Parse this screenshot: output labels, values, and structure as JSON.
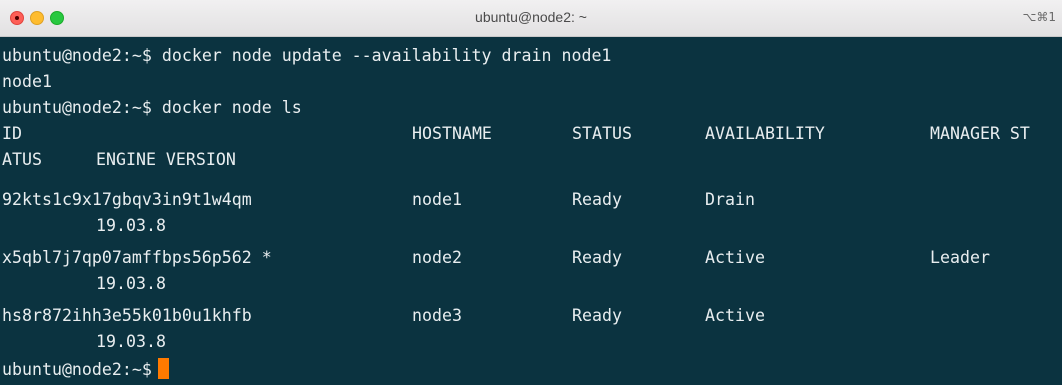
{
  "window": {
    "title": "ubuntu@node2: ~",
    "shortcut": "⌥⌘1"
  },
  "terminal": {
    "cmd1_prompt": "ubuntu@node2:~$ ",
    "cmd1_text": "docker node update --availability drain node1",
    "cmd1_output": "node1",
    "cmd2_prompt": "ubuntu@node2:~$ ",
    "cmd2_text": "docker node ls",
    "header": {
      "id": "ID",
      "hostname": "HOSTNAME",
      "status": "STATUS",
      "availability": "AVAILABILITY",
      "manager_part1": "MANAGER ST",
      "manager_part2": "ATUS",
      "engine": "ENGINE VERSION"
    },
    "rows": [
      {
        "id": "92kts1c9x17gbqv3in9t1w4qm",
        "hostname": "node1",
        "status": "Ready",
        "availability": "Drain",
        "manager": "",
        "engine": "19.03.8"
      },
      {
        "id": "x5qbl7j7qp07amffbps56p562 *",
        "hostname": "node2",
        "status": "Ready",
        "availability": "Active",
        "manager": "Leader",
        "engine": "19.03.8"
      },
      {
        "id": "hs8r872ihh3e55k01b0u1khfb",
        "hostname": "node3",
        "status": "Ready",
        "availability": "Active",
        "manager": "",
        "engine": "19.03.8"
      }
    ],
    "final_prompt": "ubuntu@node2:~$"
  },
  "colors": {
    "background": "#0b3340",
    "foreground": "#e9eef0",
    "cursor": "#ff7a00"
  }
}
